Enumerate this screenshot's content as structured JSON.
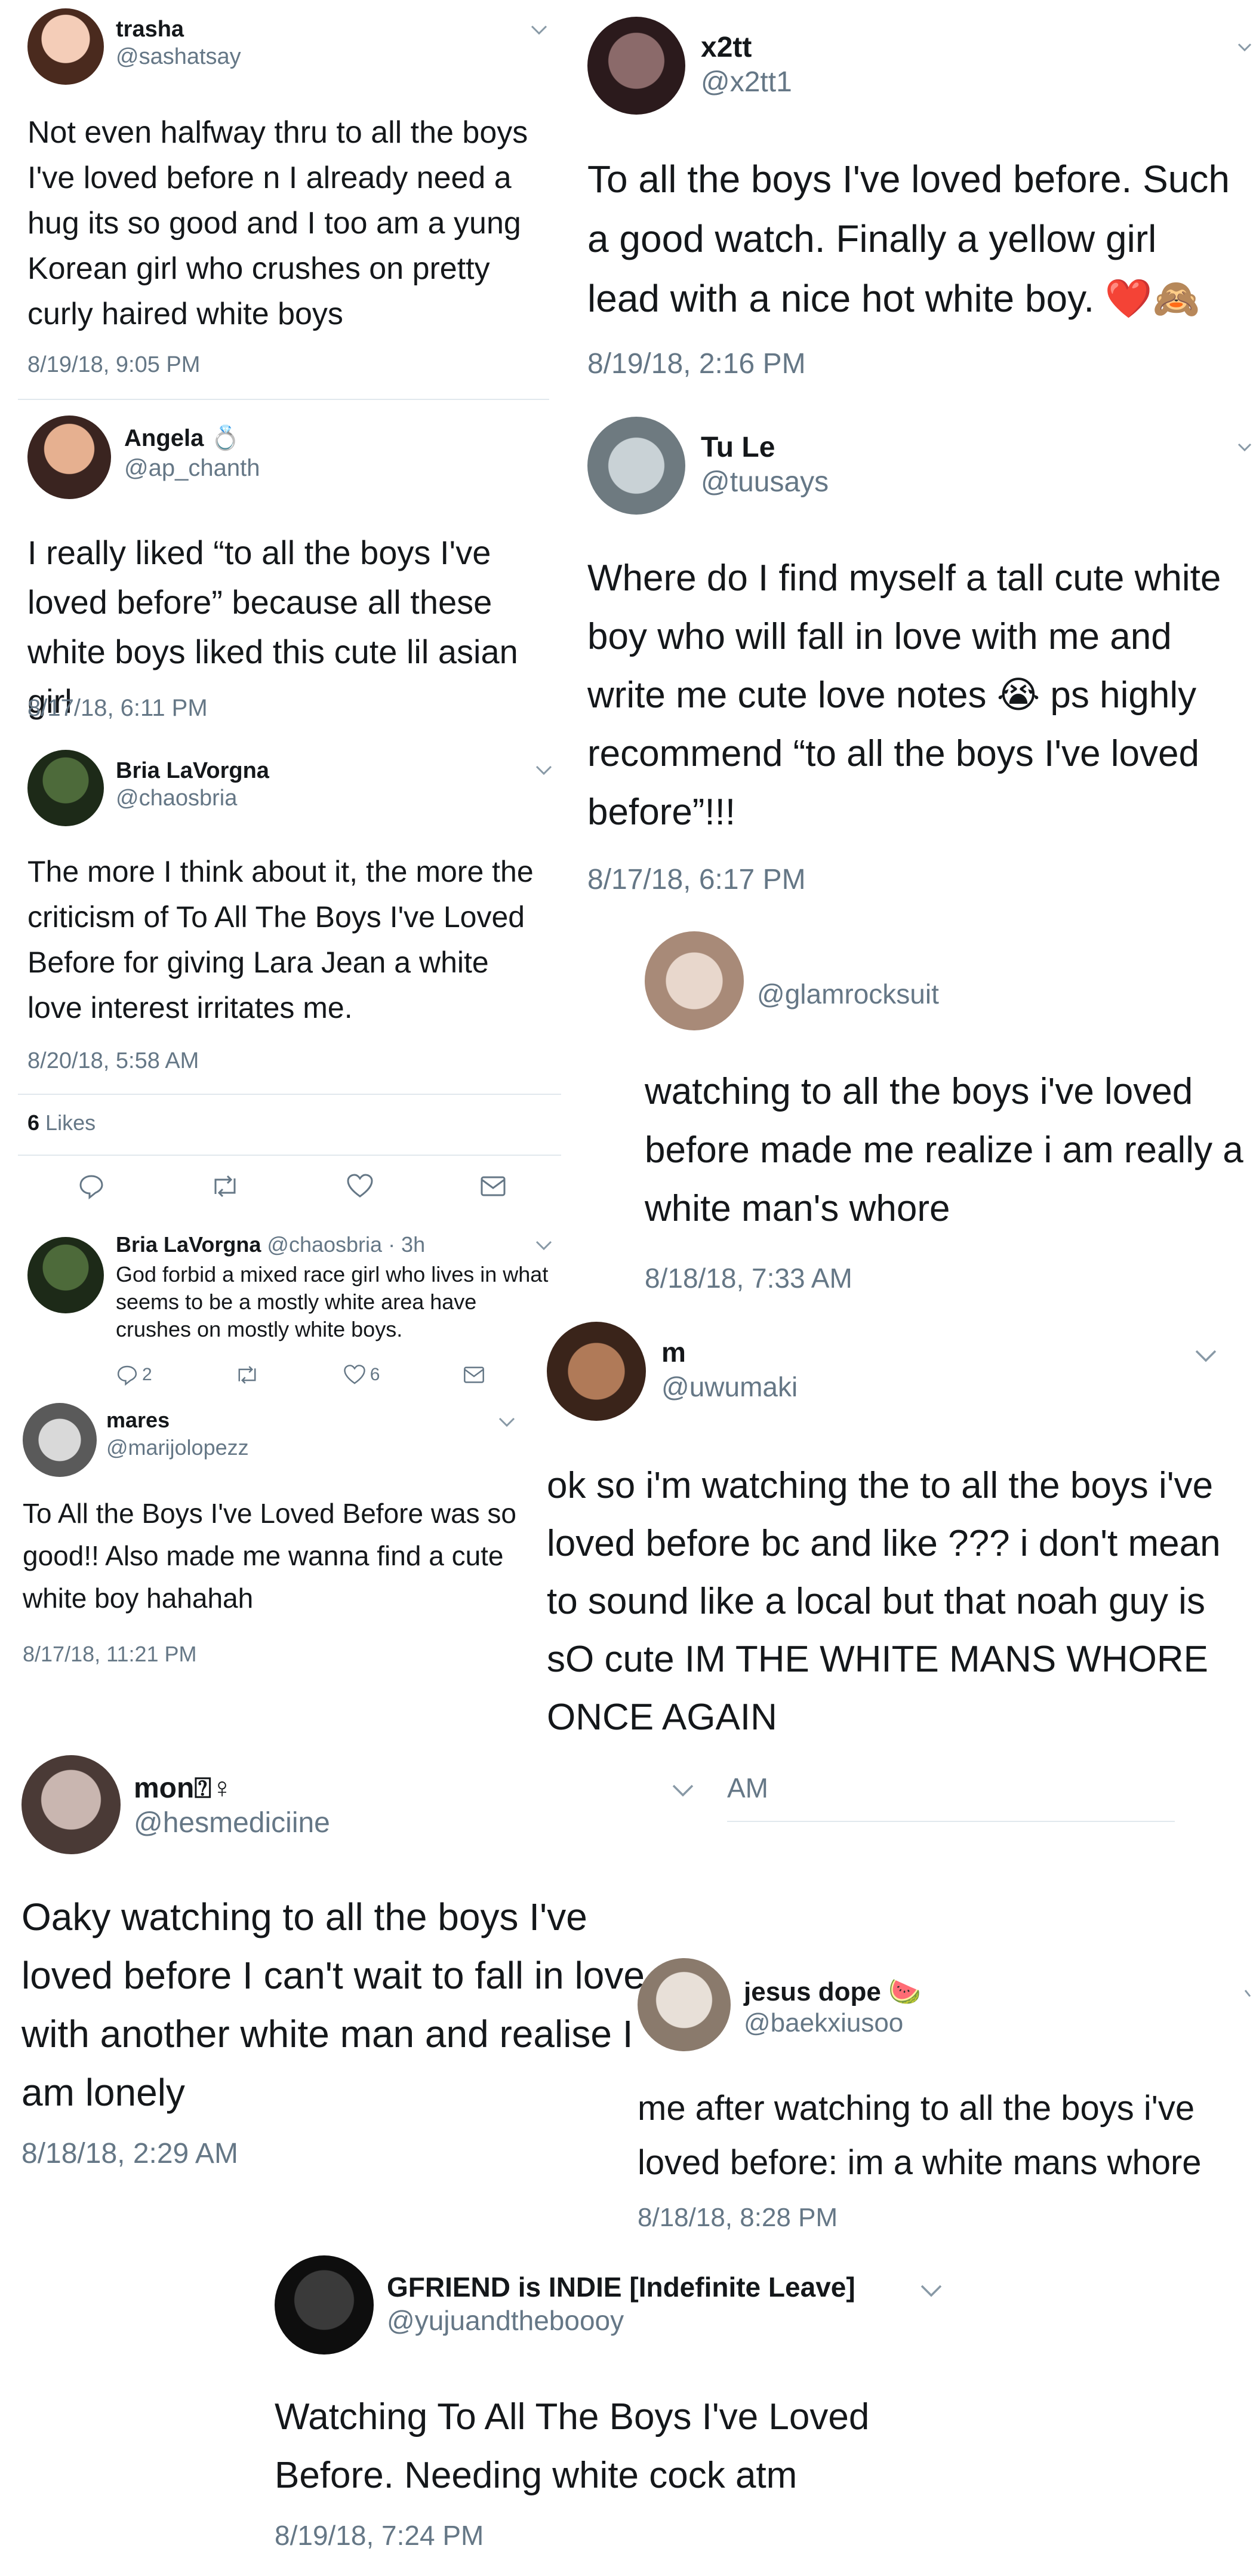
{
  "tweets": [
    {
      "name": "trasha",
      "handle": "@sashatsay",
      "text": "Not even halfway thru to all the boys I've loved before n I already need a hug its so good and I too am a yung Korean girl who crushes on pretty curly haired white boys",
      "time": "8/19/18, 9:05 PM",
      "colors": [
        "#f4cdb8",
        "#4a2a1e"
      ]
    },
    {
      "name": "x2tt",
      "handle": "@x2tt1",
      "text": "To all the boys I've loved before. Such a good watch. Finally a yellow girl lead with a nice hot white boy. ❤️🙈",
      "time": "8/19/18, 2:16 PM",
      "colors": [
        "#8b6a6a",
        "#2b1a1c"
      ]
    },
    {
      "name": "Angela 💍",
      "handle": "@ap_chanth",
      "text": "I really liked “to all the boys I've loved before” because all these white boys liked this cute lil asian girl",
      "time": "8/17/18, 6:11 PM",
      "colors": [
        "#e6b090",
        "#3a2420"
      ]
    },
    {
      "name": "Tu Le",
      "handle": "@tuusays",
      "text": "Where do I find myself a tall cute white boy who will fall in love with me and write me cute love notes 😭 ps highly recommend “to all the boys I've loved before”!!!",
      "time": "8/17/18, 6:17 PM",
      "colors": [
        "#c9d2d6",
        "#6e7a80"
      ]
    },
    {
      "name": "Bria LaVorgna",
      "handle": "@chaosbria",
      "text": "The more I think about it, the more the criticism of To All The Boys I've Loved Before for giving Lara Jean a white love interest irritates me.",
      "time": "8/20/18, 5:58 AM",
      "likes_count": "6",
      "likes_label": "Likes",
      "colors": [
        "#4d6a3a",
        "#1d2a18"
      ]
    },
    {
      "name": "Bria LaVorgna",
      "handle": "@chaosbria",
      "meta": "· 3h",
      "text": "God forbid a mixed race girl who lives in what seems to be a mostly white area have crushes on mostly white boys.",
      "replies": "2",
      "likes": "6",
      "colors": [
        "#4d6a3a",
        "#1d2a18"
      ]
    },
    {
      "name": "",
      "handle": "@glamrocksuit",
      "text": "watching to all the boys i've loved before made me realize i am really a white man's whore",
      "time": "8/18/18, 7:33 AM",
      "colors": [
        "#e8d7cc",
        "#a88a78"
      ]
    },
    {
      "name": "mares",
      "handle": "@marijolopezz",
      "text": "To All the Boys I've Loved Before was so good!! Also made me wanna find a cute white boy hahahah",
      "time": "8/17/18, 11:21 PM",
      "colors": [
        "#d9d9d9",
        "#5a5a5a"
      ]
    },
    {
      "name": "m",
      "handle": "@uwumaki",
      "text": "ok so i'm watching the to all the boys i've loved before bc and like ??? i don't mean to sound like a local but that noah guy is sO cute IM THE WHITE MANS WHORE ONCE AGAIN",
      "time": "AM",
      "colors": [
        "#b07a58",
        "#3a241a"
      ]
    },
    {
      "name": "mon⍰♀",
      "handle": "@hesmediciine",
      "text": "Oaky watching to all the boys I've loved before I can't wait to fall in love with another white man and realise I am lonely",
      "time": "8/18/18, 2:29 AM",
      "colors": [
        "#c9b6b0",
        "#4a3a36"
      ]
    },
    {
      "name": "jesus dope 🍉",
      "handle": "@baekxiusoo",
      "text": "me after watching to all the boys i've loved before: im a white mans whore",
      "time": "8/18/18, 8:28 PM",
      "colors": [
        "#e8e0d8",
        "#8a7a6c"
      ]
    },
    {
      "name": "GFRIEND is INDIE [Indefinite Leave]",
      "handle": "@yujuandtheboooy",
      "text": "Watching To All The Boys I've Loved Before. Needing white cock atm",
      "time": "8/19/18, 7:24 PM",
      "colors": [
        "#3a3a3a",
        "#0e0e0e"
      ]
    }
  ]
}
